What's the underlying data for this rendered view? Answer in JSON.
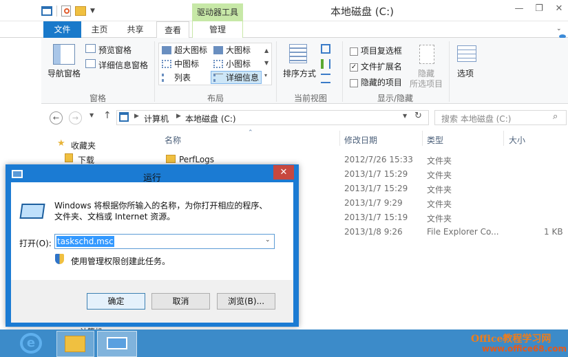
{
  "window": {
    "title": "本地磁盘 (C:)",
    "context_tab": "驱动器工具"
  },
  "ribbon_tabs": [
    "文件",
    "主页",
    "共享",
    "查看",
    "管理"
  ],
  "ribbon": {
    "pane_group": {
      "nav_pane": "导航窗格",
      "preview": "预览窗格",
      "details": "详细信息窗格",
      "label": "窗格"
    },
    "layout_group": {
      "items": [
        "超大图标",
        "大图标",
        "中图标",
        "小图标",
        "列表",
        "详细信息"
      ],
      "label": "布局"
    },
    "view_group": {
      "sort": "排序方式",
      "label": "当前视图"
    },
    "show_group": {
      "item_checkbox": "项目复选框",
      "file_ext": "文件扩展名",
      "hidden_items": "隐藏的项目",
      "hide": "隐藏",
      "hide_selected": "所选项目",
      "label": "显示/隐藏"
    },
    "options": "选项"
  },
  "address": {
    "segments": [
      "计算机",
      "本地磁盘 (C:)"
    ],
    "search_placeholder": "搜索 本地磁盘 (C:)"
  },
  "nav": {
    "favorites": "收藏夹",
    "downloads": "下载",
    "computer": "计算机"
  },
  "columns": {
    "name": "名称",
    "date": "修改日期",
    "type": "类型",
    "size": "大小"
  },
  "files": [
    {
      "name": "PerfLogs",
      "date": "2012/7/26 15:33",
      "type": "文件夹",
      "size": ""
    },
    {
      "name": "",
      "date": "2013/1/7 15:29",
      "type": "文件夹",
      "size": ""
    },
    {
      "name": "",
      "date": "2013/1/7 15:29",
      "type": "文件夹",
      "size": ""
    },
    {
      "name": "",
      "date": "2013/1/7 9:29",
      "type": "文件夹",
      "size": ""
    },
    {
      "name": "",
      "date": "2013/1/7 15:19",
      "type": "文件夹",
      "size": ""
    },
    {
      "name": "",
      "date": "2013/1/8 9:26",
      "type": "File Explorer Co...",
      "size": "1 KB"
    }
  ],
  "run_dialog": {
    "title": "运行",
    "description": "Windows 将根据你所输入的名称，为你打开相应的程序、文件夹、文档或 Internet 资源。",
    "open_label": "打开(O):",
    "input_value": "taskschd.msc",
    "admin_note": "使用管理权限创建此任务。",
    "ok": "确定",
    "cancel": "取消",
    "browse": "浏览(B)..."
  },
  "watermark": {
    "line1": "Office教程学习网",
    "line2": "www.office68.com"
  }
}
